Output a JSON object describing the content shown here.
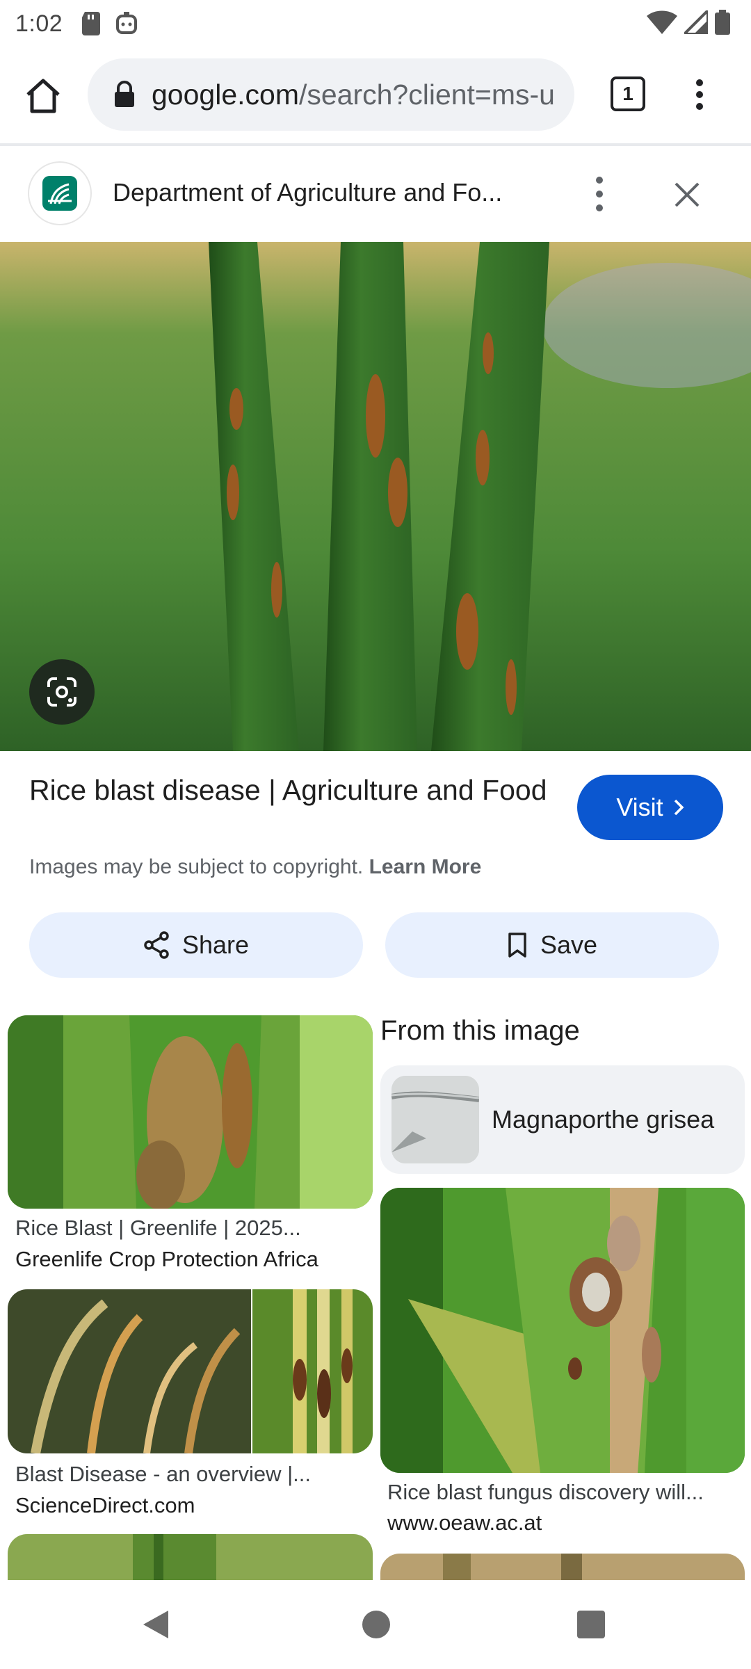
{
  "status_bar": {
    "time": "1:02",
    "left_icons": [
      "sd-card-icon",
      "assistant-icon"
    ],
    "right_icons": [
      "wifi-icon",
      "signal-icon",
      "battery-icon"
    ]
  },
  "browser": {
    "url_domain": "google.com",
    "url_path": "/search?client=ms-u",
    "tab_count": "1"
  },
  "site": {
    "title": "Department of Agriculture and Fo..."
  },
  "result": {
    "title": "Rice blast disease | Agriculture and Food",
    "visit_label": "Visit",
    "copyright_text": "Images may be subject to copyright.",
    "learn_more": "Learn More",
    "share_label": "Share",
    "save_label": "Save"
  },
  "related": {
    "left": [
      {
        "caption": "Rice Blast | Greenlife | 2025...",
        "source": "Greenlife Crop Protection Africa"
      },
      {
        "caption": "Blast Disease - an overview |...",
        "source": "ScienceDirect.com"
      }
    ],
    "from_heading": "From this image",
    "entity": "Magnaporthe grisea",
    "right": [
      {
        "caption": "Rice blast fungus discovery will...",
        "source": "www.oeaw.ac.at"
      }
    ]
  },
  "colors": {
    "accent": "#0b57d0",
    "tonal_button": "#e8f0fe",
    "card_bg": "#f0f2f5"
  }
}
